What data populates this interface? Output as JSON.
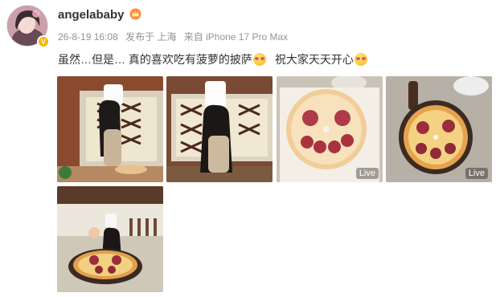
{
  "user": {
    "name": "angelababy",
    "avatar_icon": "avatar-photo",
    "verified_icon": "verified-v-icon",
    "vip_icon": "vip-crown-icon"
  },
  "meta": {
    "timestamp": "26-8-19 16:08",
    "location": "发布于 上海",
    "device": "来自 iPhone 17 Pro Max"
  },
  "post": {
    "text_part1": "虽然…但是… 真的喜欢吃有菠萝的披萨",
    "emoji1": "love-face-emoji",
    "text_part2": "祝大家天天开心",
    "emoji2": "love-face-emoji"
  },
  "photos": [
    {
      "subject": "chef-making-pizza-side",
      "live": ""
    },
    {
      "subject": "chef-making-pizza-front",
      "live": ""
    },
    {
      "subject": "smiley-pizza-raw",
      "live": "Live"
    },
    {
      "subject": "smiley-pizza-baked",
      "live": "Live"
    },
    {
      "subject": "chef-with-baked-pizza",
      "live": ""
    }
  ],
  "colors": {
    "username": "#333333",
    "meta": "#939393",
    "verified": "#f7b500"
  }
}
